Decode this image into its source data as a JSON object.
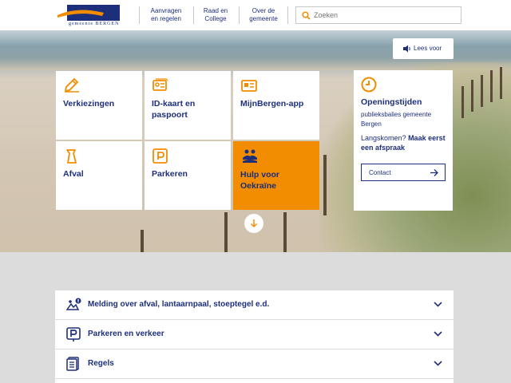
{
  "header": {
    "logo_text": "gemeente BERGEN",
    "nav": [
      {
        "label_line1": "Aanvragen",
        "label_line2": "en regelen"
      },
      {
        "label_line1": "Raad en",
        "label_line2": "College"
      },
      {
        "label_line1": "Over de",
        "label_line2": "gemeente"
      }
    ],
    "search": {
      "placeholder": "Zoeken",
      "icon": "search-icon"
    }
  },
  "hero": {
    "lees_voor_label": "Lees voor",
    "scroll_icon": "arrow-down-icon"
  },
  "tiles": [
    {
      "label": "Verkiezingen",
      "icon": "pencil-icon"
    },
    {
      "label": "ID-kaart en paspoort",
      "icon": "id-card-icon"
    },
    {
      "label": "MijnBergen-app",
      "icon": "app-icon"
    },
    {
      "label": "Afval",
      "icon": "bin-icon"
    },
    {
      "label": "Parkeren",
      "icon": "parking-icon"
    },
    {
      "label": "Hulp voor Oekraïne",
      "icon": "help-people-icon"
    }
  ],
  "opening": {
    "title": "Openingstijden",
    "description": "publieksbalies gemeente Bergen",
    "visit_prefix": "Langskomen?",
    "visit_link": "Maak eerst een afspraak",
    "contact_label": "Contact"
  },
  "accordion": [
    {
      "label": "Melding over afval, lantaarnpaal, stoeptegel e.d.",
      "icon": "report-icon"
    },
    {
      "label": "Parkeren en verkeer",
      "icon": "parking-icon"
    },
    {
      "label": "Regels",
      "icon": "document-icon"
    }
  ],
  "colors": {
    "brand_blue": "#1d2f7a",
    "accent_orange": "#f28c00"
  }
}
